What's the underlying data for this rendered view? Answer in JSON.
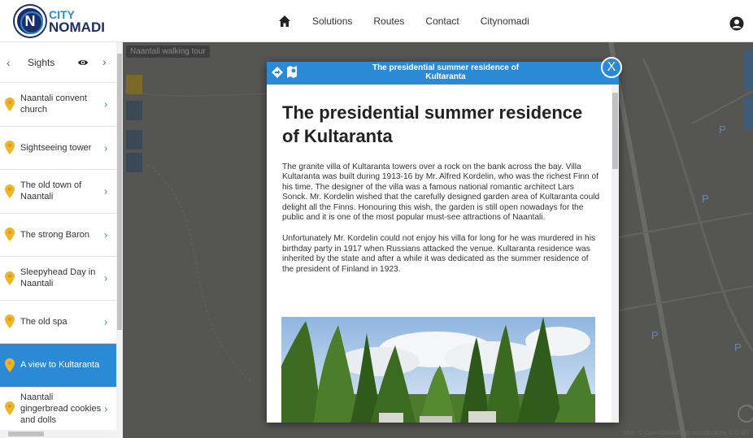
{
  "logo": {
    "city": "CITY",
    "nomadi": "NOMADI",
    "initial": "N"
  },
  "nav": {
    "items": [
      "Solutions",
      "Routes",
      "Contact",
      "Citynomadi"
    ]
  },
  "sidebar": {
    "title": "Sights",
    "items": [
      {
        "label": "Naantali convent church"
      },
      {
        "label": "Sightseeing tower"
      },
      {
        "label": "The old town of Naantali"
      },
      {
        "label": "The strong Baron"
      },
      {
        "label": "Sleepyhead Day in Naantali"
      },
      {
        "label": "The old spa"
      },
      {
        "label": "A view to Kultaranta",
        "active": true
      },
      {
        "label": "Naantali gingerbread cookies and dolls"
      }
    ]
  },
  "map": {
    "tour_tag": "Naantali walking tour",
    "attribution": "Map © OpenStreetMap contributors, CC-BY"
  },
  "modal": {
    "header_title": "The presidential summer residence of Kultaranta",
    "heading": "The presidential summer residence of Kultaranta",
    "paragraphs": [
      "The granite villa of Kultaranta towers over a rock on the bank across the bay. Villa Kultaranta was built during 1913-16 by Mr. Alfred Kordelin, who was the richest Finn of his time. The designer of the villa was a famous national romantic architect Lars Sonck. Mr. Kordelin wished that the carefully designed garden area of Kultaranta could delight all the Finns. Honouring this wish, the garden is still open nowadays for the public and it is one of the most popular must-see attractions of Naantali.",
      "Unfortunately Mr. Kordelin could not enjoy his villa for long for he was murdered in his birthday party in 1917 when Russians attacked the venue. Kultaranta residence was inherited by the state and after a while it was dedicated as the summer residence of the president of Finland in 1923."
    ],
    "close_label": "X"
  },
  "colors": {
    "accent": "#2b8ad6",
    "brand_dark": "#1a2e6a",
    "pin": "#f0b429"
  }
}
